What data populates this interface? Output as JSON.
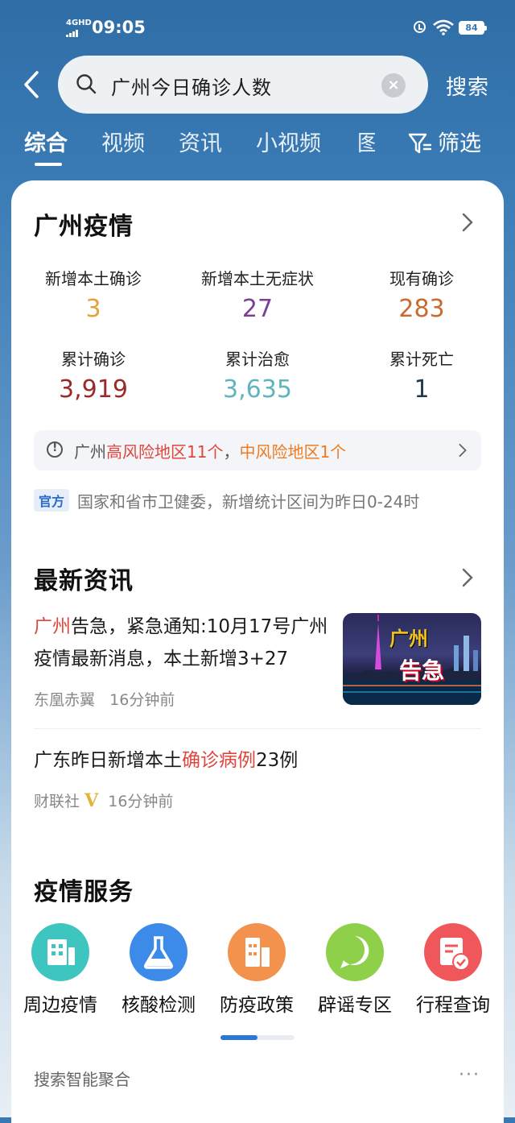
{
  "status": {
    "network": "4GHD",
    "time": "09:05",
    "battery": "84"
  },
  "search": {
    "query": "广州今日确诊人数",
    "button": "搜索"
  },
  "tabs": [
    "综合",
    "视频",
    "资讯",
    "小视频",
    "图"
  ],
  "filter_label": "筛选",
  "epidemic": {
    "title": "广州疫情",
    "stats": [
      {
        "label": "新增本土确诊",
        "value": "3",
        "color": "#e0a43a"
      },
      {
        "label": "新增本土无症状",
        "value": "27",
        "color": "#7b3f9a"
      },
      {
        "label": "现有确诊",
        "value": "283",
        "color": "#c96a2e"
      },
      {
        "label": "累计确诊",
        "value": "3,919",
        "color": "#9b2a2a"
      },
      {
        "label": "累计治愈",
        "value": "3,635",
        "color": "#5fb4bd"
      },
      {
        "label": "累计死亡",
        "value": "1",
        "color": "#1d3a55"
      }
    ],
    "risk": {
      "prefix": "广州",
      "high": "高风险地区11个",
      "sep": "，",
      "mid": "中风险地区1个"
    },
    "official_tag": "官方",
    "official_text": "国家和省市卫健委，新增统计区间为昨日0-24时"
  },
  "news": {
    "title": "最新资讯",
    "items": [
      {
        "title_highlight": "广州",
        "title_rest": "告急，紧急通知:10月17号广州疫情最新消息，本土新增3+27",
        "source": "东凰赤翼",
        "time": "16分钟前",
        "thumb_text1": "广州",
        "thumb_text2": "告急"
      },
      {
        "title_pre": "广东昨日新增本土",
        "title_highlight": "确诊病例",
        "title_post": "23例",
        "source": "财联社",
        "verified": "V",
        "time": "16分钟前"
      }
    ]
  },
  "services": {
    "title": "疫情服务",
    "items": [
      {
        "label": "周边疫情",
        "icon": "building-grid-icon",
        "color": "#3ec5bf"
      },
      {
        "label": "核酸检测",
        "icon": "flask-icon",
        "color": "#3c8be8"
      },
      {
        "label": "防疫政策",
        "icon": "building-icon",
        "color": "#f3924d"
      },
      {
        "label": "辟谣专区",
        "icon": "question-bubble-icon",
        "color": "#8fd04a"
      },
      {
        "label": "行程查询",
        "icon": "document-check-icon",
        "color": "#f0575a"
      }
    ]
  },
  "footer": {
    "aggregate": "搜索智能聚合",
    "more": "···"
  }
}
